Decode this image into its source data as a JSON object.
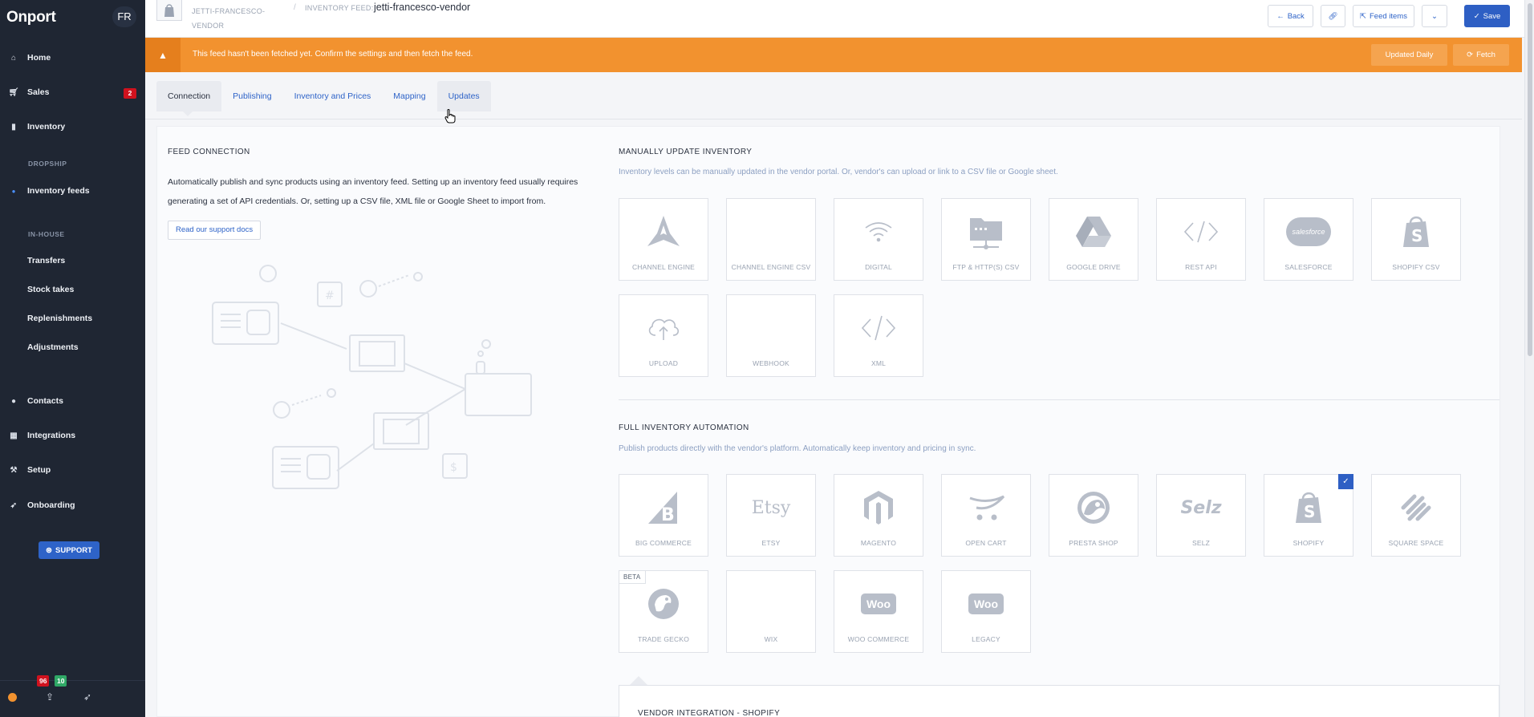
{
  "sidebar": {
    "brand": "Onport",
    "avatar": "FR",
    "items": [
      {
        "label": "Home",
        "icon": "home-icon"
      },
      {
        "label": "Sales",
        "icon": "cart-icon",
        "badge": "2"
      },
      {
        "label": "Inventory",
        "icon": "bookmark-icon"
      },
      {
        "label": "Inventory feeds",
        "icon": "dot-icon"
      },
      {
        "label": "Transfers"
      },
      {
        "label": "Stock takes"
      },
      {
        "label": "Replenishments"
      },
      {
        "label": "Adjustments"
      },
      {
        "label": "Contacts",
        "icon": "user-icon"
      },
      {
        "label": "Integrations",
        "icon": "grid-icon"
      },
      {
        "label": "Setup",
        "icon": "wrench-icon"
      },
      {
        "label": "Onboarding",
        "icon": "rocket-icon"
      }
    ],
    "sections": {
      "dropship": "DROPSHIP",
      "inhouse": "IN-HOUSE"
    },
    "support_label": "SUPPORT",
    "footer_badges": {
      "red": "96",
      "green": "10"
    }
  },
  "header": {
    "vendor_name": "JETTI-FRANCESCO-VENDOR",
    "feed_label": "INVENTORY FEED:",
    "feed_name": "jetti-francesco-vendor",
    "back_label": "Back",
    "feed_items_label": "Feed items",
    "save_label": "Save"
  },
  "alert": {
    "message": "This feed hasn't been fetched yet. Confirm the settings and then fetch the feed.",
    "updated_label": "Updated Daily",
    "fetch_label": "Fetch"
  },
  "tabs": [
    "Connection",
    "Publishing",
    "Inventory and Prices",
    "Mapping",
    "Updates"
  ],
  "feed_connection": {
    "title": "FEED CONNECTION",
    "desc_line1": "Automatically publish and sync products using an inventory feed. Setting up an inventory feed usually requires",
    "desc_line2": "generating a set of API credentials. Or, setting up a CSV file, XML file or Google Sheet to import from.",
    "docs_label": "Read our support docs"
  },
  "manual": {
    "title": "MANUALLY UPDATE INVENTORY",
    "desc": "Inventory levels can be manually updated in the vendor portal. Or, vendor's can upload or link to a CSV file or Google sheet.",
    "tiles": [
      {
        "label": "CHANNEL ENGINE",
        "icon": "channel-engine-logo"
      },
      {
        "label": "CHANNEL ENGINE CSV",
        "icon": "none"
      },
      {
        "label": "DIGITAL",
        "icon": "wifi-icon"
      },
      {
        "label": "FTP & HTTP(S) CSV",
        "icon": "folder-network-icon"
      },
      {
        "label": "GOOGLE DRIVE",
        "icon": "google-drive-logo"
      },
      {
        "label": "REST API",
        "icon": "code-icon"
      },
      {
        "label": "SALESFORCE",
        "icon": "salesforce-logo",
        "logo_text": "salesforce"
      },
      {
        "label": "SHOPIFY CSV",
        "icon": "shopify-logo"
      },
      {
        "label": "UPLOAD",
        "icon": "cloud-upload-icon"
      },
      {
        "label": "WEBHOOK",
        "icon": "none"
      },
      {
        "label": "XML",
        "icon": "code-icon"
      }
    ]
  },
  "automation": {
    "title": "FULL INVENTORY AUTOMATION",
    "desc": "Publish products directly with the vendor's platform. Automatically keep inventory and pricing in sync.",
    "tiles": [
      {
        "label": "BIG COMMERCE",
        "icon": "bigcommerce-logo"
      },
      {
        "label": "ETSY",
        "icon": "etsy-logo",
        "logo_text": "Etsy"
      },
      {
        "label": "MAGENTO",
        "icon": "magento-logo"
      },
      {
        "label": "OPEN CART",
        "icon": "opencart-logo"
      },
      {
        "label": "PRESTA SHOP",
        "icon": "prestashop-logo"
      },
      {
        "label": "SELZ",
        "icon": "selz-logo",
        "logo_text": "Selz"
      },
      {
        "label": "SHOPIFY",
        "icon": "shopify-logo",
        "selected": true
      },
      {
        "label": "SQUARE SPACE",
        "icon": "squarespace-logo"
      },
      {
        "label": "TRADE GECKO",
        "icon": "tradegecko-logo",
        "beta": "BETA"
      },
      {
        "label": "WIX",
        "icon": "none"
      },
      {
        "label": "WOO COMMERCE",
        "icon": "woo-logo",
        "logo_text": "Woo"
      },
      {
        "label": "LEGACY",
        "icon": "woo-logo",
        "logo_text": "Woo"
      }
    ]
  },
  "vendor_integration": {
    "title": "VENDOR INTEGRATION - SHOPIFY"
  },
  "colors": {
    "sidebar": "#1f2633",
    "alert": "#f2922f",
    "primary": "#2e5fc4",
    "badge_red": "#d0121e",
    "badge_green": "#2fa866"
  }
}
